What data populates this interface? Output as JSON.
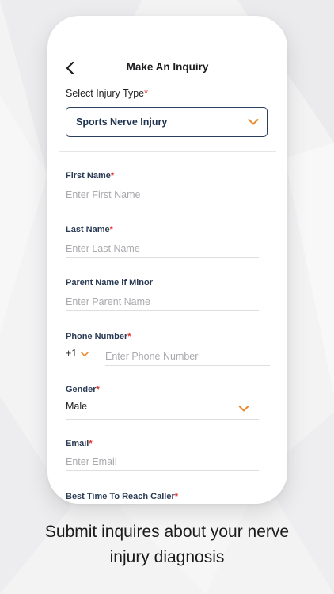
{
  "header": {
    "title": "Make An Inquiry"
  },
  "injury": {
    "label": "Select Injury Type",
    "required": "*",
    "selected": "Sports Nerve Injury"
  },
  "fields": {
    "first_name": {
      "label": "First Name",
      "required": "*",
      "placeholder": "Enter First Name"
    },
    "last_name": {
      "label": "Last Name",
      "required": "*",
      "placeholder": "Enter Last Name"
    },
    "parent_name": {
      "label": "Parent Name if Minor",
      "placeholder": "Enter Parent Name"
    },
    "phone": {
      "label": "Phone Number",
      "required": "*",
      "country_code": "+1",
      "placeholder": "Enter Phone Number"
    },
    "gender": {
      "label": "Gender",
      "required": "*",
      "value": "Male"
    },
    "email": {
      "label": "Email",
      "required": "*",
      "placeholder": "Enter Email"
    },
    "best_time": {
      "label": "Best Time To Reach Caller",
      "required": "*"
    }
  },
  "caption": {
    "line1": "Submit inquires about your nerve",
    "line2": "injury diagnosis"
  },
  "colors": {
    "accent": "#e88a2d",
    "required": "#e5322b",
    "navy": "#1f3350"
  },
  "icons": {
    "back": "chevron-left-icon",
    "dropdown": "chevron-down-icon"
  }
}
